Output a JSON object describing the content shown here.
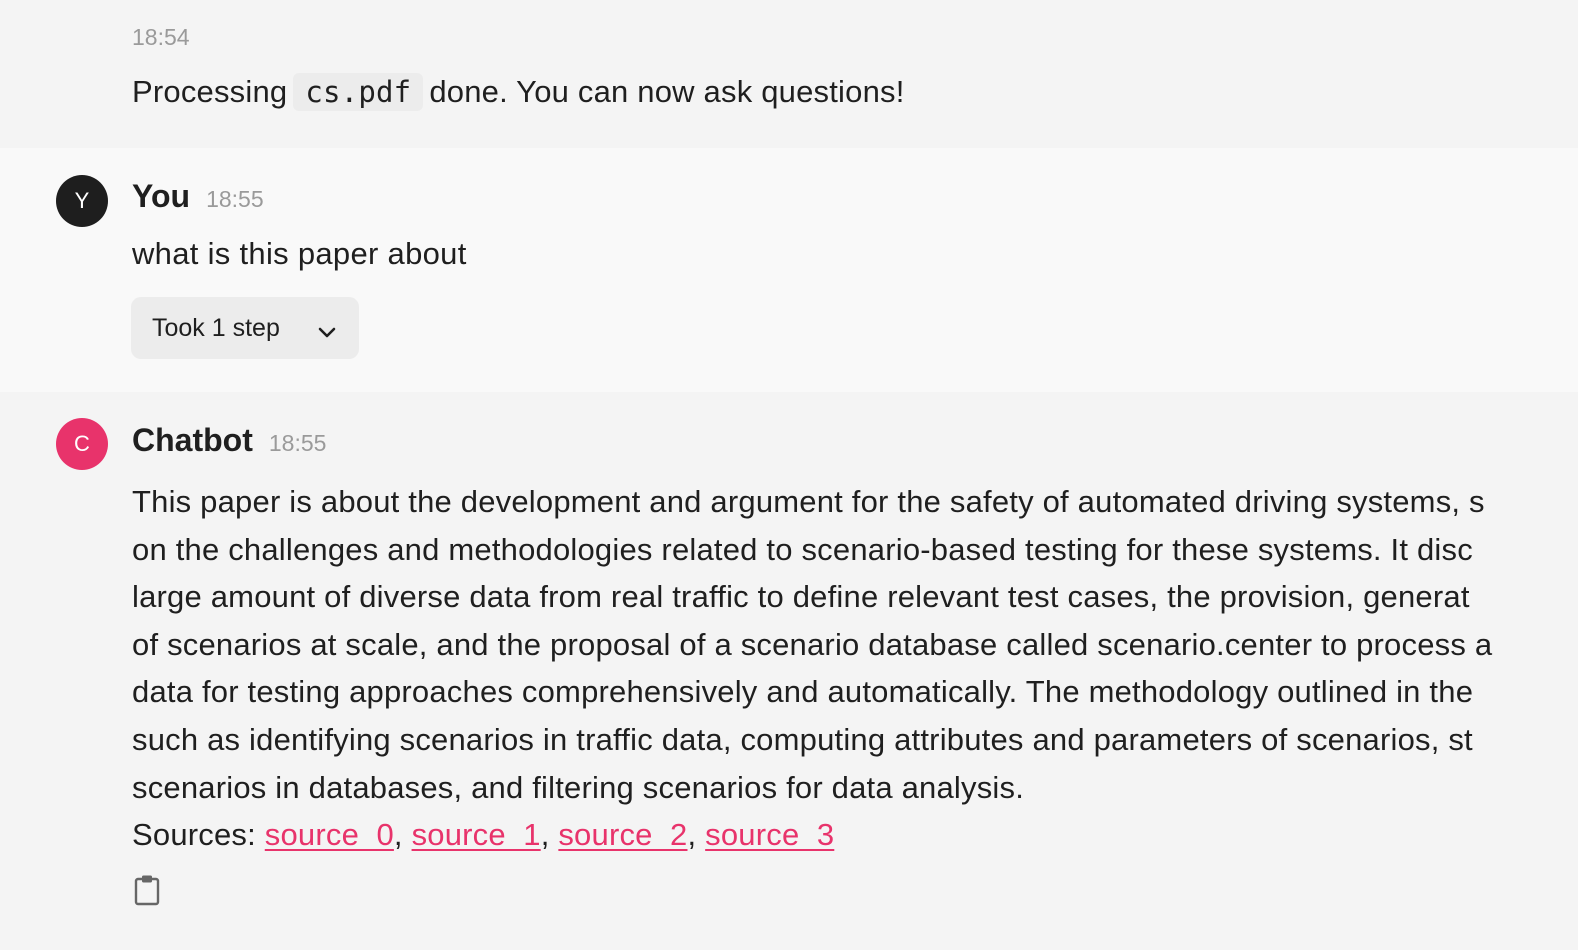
{
  "system_message": {
    "time": "18:54",
    "text_before": "Processing",
    "file_name": "cs.pdf",
    "text_after": "done. You can now ask questions!"
  },
  "user_message": {
    "avatar_letter": "Y",
    "author": "You",
    "time": "18:55",
    "text": "what is this paper about",
    "steps_label": "Took 1 step",
    "steps_icon": "chevron-down-icon"
  },
  "bot_message": {
    "avatar_letter": "C",
    "author": "Chatbot",
    "time": "18:55",
    "lines": [
      "This paper is about the development and argument for the safety of automated driving systems, s",
      "on the challenges and methodologies related to scenario-based testing for these systems. It disc",
      "large amount of diverse data from real traffic to define relevant test cases, the provision, generat",
      "of scenarios at scale, and the proposal of a scenario database called scenario.center to process a",
      "data for testing approaches comprehensively and automatically. The methodology outlined in the",
      "such as identifying scenarios in traffic data, computing attributes and parameters of scenarios, st",
      "scenarios in databases, and filtering scenarios for data analysis."
    ],
    "sources_label": "Sources:",
    "sources": [
      "source_0",
      "source_1",
      "source_2",
      "source_3"
    ],
    "separator": ",",
    "copy_icon": "clipboard-icon"
  },
  "colors": {
    "accent": "#e8336b",
    "user_avatar": "#1e1e1e",
    "bg_system": "#f4f4f4",
    "bg_user": "#f9f9f9",
    "bg_bot": "#f4f4f4"
  }
}
